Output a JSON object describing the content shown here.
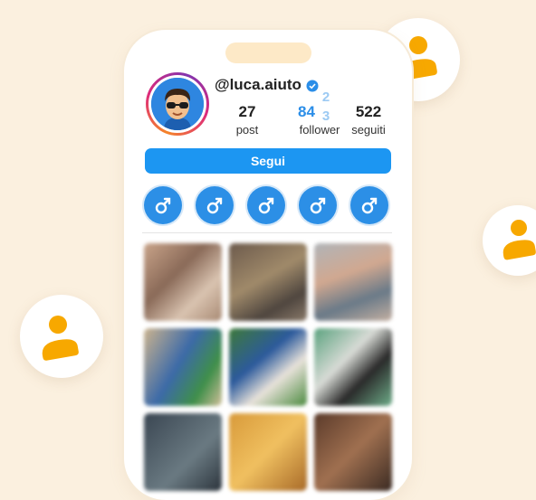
{
  "profile": {
    "username": "@luca.aiuto",
    "stats": {
      "posts_value": "27",
      "posts_label": "post",
      "followers_value": "84",
      "followers_roll_top": "2",
      "followers_roll_bottom": "3",
      "followers_label": "follower",
      "following_value": "522",
      "following_label": "seguiti"
    },
    "follow_button_label": "Segui"
  },
  "highlights": [
    {
      "icon": "male-symbol-icon"
    },
    {
      "icon": "male-symbol-icon"
    },
    {
      "icon": "male-symbol-icon"
    },
    {
      "icon": "male-symbol-icon"
    },
    {
      "icon": "male-symbol-icon"
    }
  ],
  "colors": {
    "accent": "#1c96f2",
    "background": "#fbf0df",
    "user_icon": "#f7a800",
    "followers_number": "#2b8ee8"
  }
}
